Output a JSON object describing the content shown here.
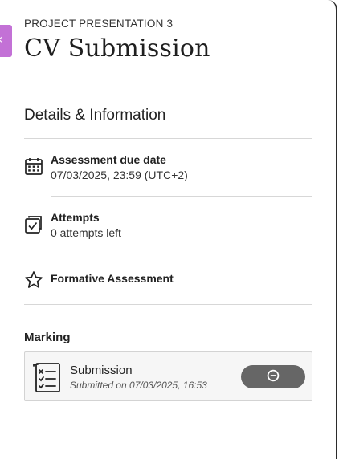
{
  "header": {
    "overline": "PROJECT PRESENTATION 3",
    "title": "CV Submission"
  },
  "details": {
    "section_title": "Details & Information",
    "due_date": {
      "icon": "calendar-icon",
      "label": "Assessment due date",
      "value": "07/03/2025, 23:59 (UTC+2)"
    },
    "attempts": {
      "icon": "attempts-icon",
      "label": "Attempts",
      "value": "0 attempts left"
    },
    "formative": {
      "icon": "star-outline-icon",
      "label": "Formative Assessment"
    }
  },
  "marking": {
    "title": "Marking",
    "submission": {
      "icon": "checklist-icon",
      "name": "Submission",
      "meta": "Submitted on 07/03/2025, 16:53",
      "status_icon": "minus-circle-icon"
    }
  },
  "colors": {
    "accent_tab": "#c371d6",
    "status_pill": "#666666"
  }
}
